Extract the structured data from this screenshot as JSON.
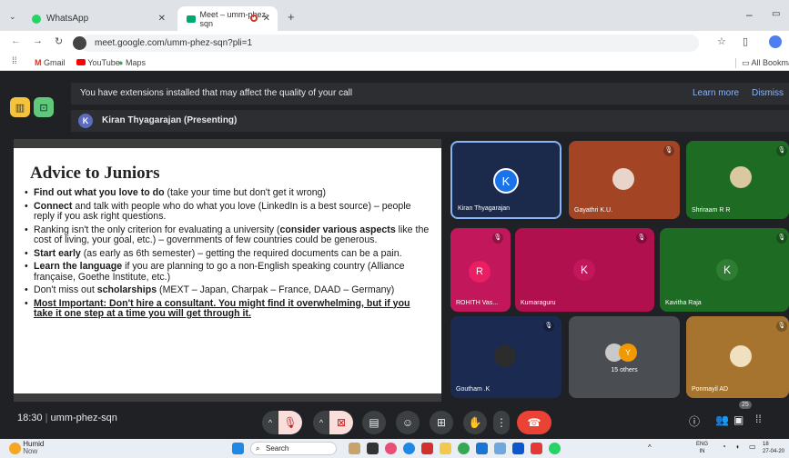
{
  "browser": {
    "tabs": [
      {
        "title": "WhatsApp"
      },
      {
        "title": "Meet – umm-phez-sqn"
      }
    ],
    "url": "meet.google.com/umm-phez-sqn?pli=1",
    "bookmarks": [
      "Gmail",
      "YouTube",
      "Maps"
    ],
    "all_bookmarks": "All Bookmar"
  },
  "meet": {
    "banner_text": "You have extensions installed that may affect the quality of your call",
    "learn_more": "Learn more",
    "dismiss": "Dismiss",
    "presenting_initial": "K",
    "presenting_text": "Kiran Thyagarajan (Presenting)",
    "slide": {
      "title": "Advice to Juniors",
      "bullets": [
        {
          "bold": "Find out what you love to do",
          "rest": " (take your time but don't get it wrong)"
        },
        {
          "bold": "Connect",
          "rest": " and talk with people who do what you love (LinkedIn is a best source) – people reply if you ask right questions."
        },
        {
          "pre": "Ranking isn't the only criterion for evaluating a university (",
          "bold": "consider various aspects",
          "rest": " like the cost of living, your goal, etc.) – governments of few countries could be generous."
        },
        {
          "bold": "Start early",
          "rest": " (as early as 6th semester) – getting the required documents can be a pain."
        },
        {
          "bold": "Learn the language",
          "rest": " if you are planning to go a non-English speaking country (Alliance française, Goethe Institute, etc.)"
        },
        {
          "pre": "Don't miss out ",
          "bold": "scholarships",
          "rest": " (MEXT – Japan, Charpak – France, DAAD – Germany)"
        },
        {
          "underline": "Most Important: Don't hire a consultant. You might find it overwhelming, but if you take it one step at a time you will get through it."
        }
      ]
    },
    "participants": [
      {
        "name": "Kiran Thyagarajan",
        "initial": "K"
      },
      {
        "name": "Gayathri K.U."
      },
      {
        "name": "Shriraam R R"
      },
      {
        "name": "ROHITH Vas...",
        "initial": "R"
      },
      {
        "name": "Kumaraguru",
        "initial": "K"
      },
      {
        "name": "Kavitha Raja",
        "initial": "K"
      },
      {
        "name": "Goutham .K"
      },
      {
        "name": "15 others",
        "initial": "Y"
      },
      {
        "name": "Ponmayil AD"
      }
    ],
    "time": "18:30",
    "meeting_code": "umm-phez-sqn",
    "people_count": "25"
  },
  "taskbar": {
    "weather": "Humid",
    "weather_sub": "Now",
    "search_placeholder": "Search",
    "lang": "ENG",
    "lang_sub": "IN",
    "clock_time": "18",
    "clock_date": "27-04-20"
  },
  "colors": {
    "accent_blue": "#8ab4f8",
    "end_call_red": "#ea4335",
    "tile_pink": "#c2185b",
    "tile_green": "#1e6b24",
    "tile_navy": "#1b2a4a",
    "tile_grey": "#4a4d52",
    "tile_tan": "#a6742f",
    "tile_brown": "#8a3b1d"
  }
}
